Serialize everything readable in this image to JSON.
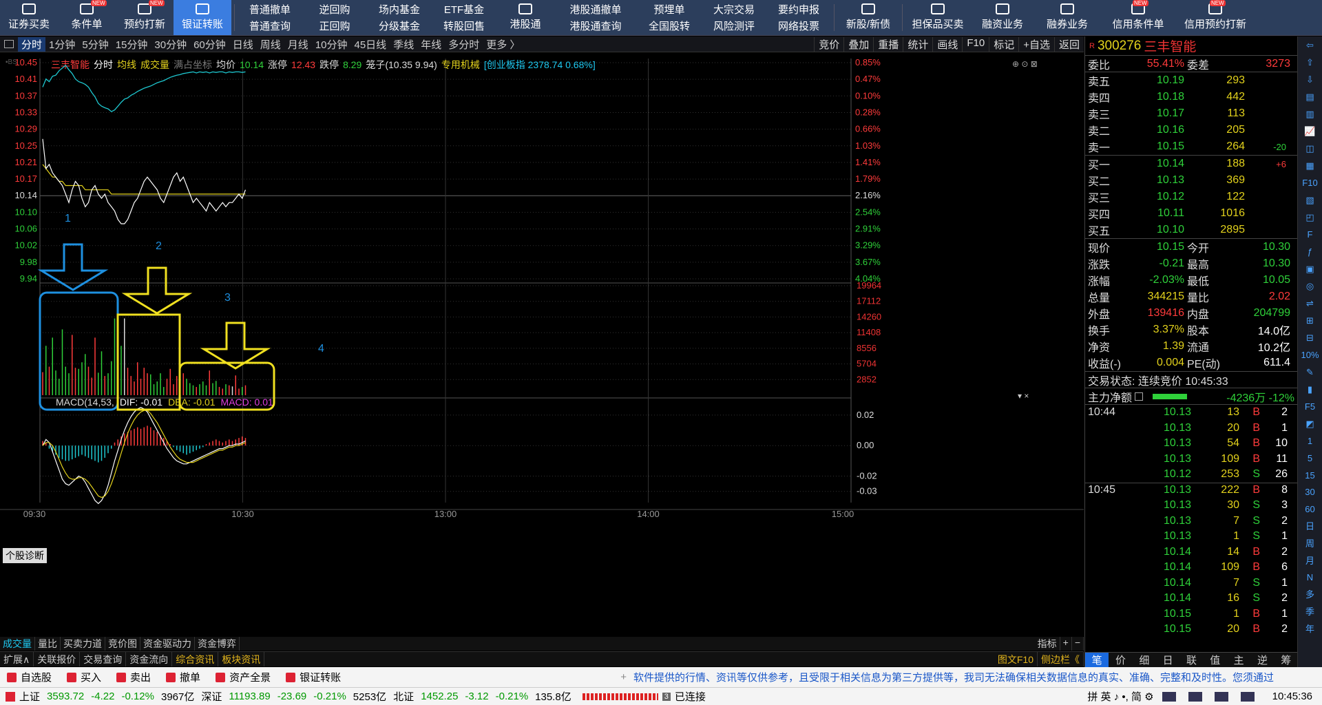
{
  "toolbar": {
    "big": [
      {
        "label": "证券买卖",
        "icon": "chart-up-icon"
      },
      {
        "label": "条件单",
        "icon": "condition-icon",
        "new": true
      },
      {
        "label": "预约打新",
        "icon": "reserve-icon",
        "new": true
      },
      {
        "label": "银证转账",
        "icon": "transfer-icon",
        "active": true
      }
    ],
    "pairs": [
      [
        "普通撤单",
        "普通查询"
      ],
      [
        "逆回购",
        "正回购"
      ],
      [
        "场内基金",
        "分级基金"
      ],
      [
        "ETF基金",
        "转股回售"
      ]
    ],
    "hk": {
      "label": "港股通",
      "icon": "hk-icon"
    },
    "pairs2": [
      [
        "港股通撤单",
        "港股通查询"
      ],
      [
        "预埋单",
        "全国股转"
      ],
      [
        "大宗交易",
        "风险测评"
      ],
      [
        "要约申报",
        "网络投票"
      ]
    ],
    "xin": {
      "label": "新股/新债",
      "icon": "new-stock-icon"
    },
    "big2": [
      {
        "label": "担保品买卖",
        "icon": "shield-icon"
      },
      {
        "label": "融资业务",
        "icon": "coin-icon"
      },
      {
        "label": "融券业务",
        "icon": "coin2-icon"
      },
      {
        "label": "信用条件单",
        "icon": "credit-condition-icon",
        "new": true
      },
      {
        "label": "信用预约打新",
        "icon": "credit-reserve-icon",
        "new": true
      }
    ],
    "new_badge": "NEW"
  },
  "period_bar": {
    "items": [
      "分时",
      "1分钟",
      "5分钟",
      "15分钟",
      "30分钟",
      "60分钟",
      "日线",
      "周线",
      "月线",
      "10分钟",
      "45日线",
      "季线",
      "年线",
      "多分时",
      "更多 〉"
    ],
    "active": "分时",
    "right": [
      "竞价",
      "叠加",
      "重播",
      "统计",
      "画线",
      "F10",
      "标记",
      "+自选",
      "返回"
    ]
  },
  "chart_header": {
    "name": "三丰智能",
    "mode": "分时",
    "avg": "均线",
    "vol": "成交量",
    "full": "满占坐标",
    "avg_price_label": "均价",
    "avg_price": "10.14",
    "limit_up_label": "涨停",
    "limit_up": "12.43",
    "limit_down_label": "跌停",
    "limit_down": "8.29",
    "range": "笼子(10.35 9.94)",
    "industry": "专用机械",
    "index": "[创业板指 2378.74 0.68%]"
  },
  "price_axis": [
    "10.45",
    "10.41",
    "10.37",
    "10.33",
    "10.29",
    "10.25",
    "10.21",
    "10.17",
    "10.14",
    "10.10",
    "10.06",
    "10.02",
    "9.98",
    "9.94"
  ],
  "pct_axis": [
    "0.85%",
    "0.47%",
    "0.10%",
    "0.28%",
    "0.66%",
    "1.03%",
    "1.41%",
    "1.79%",
    "2.16%",
    "2.54%",
    "2.91%",
    "3.29%",
    "3.67%",
    "4.04%"
  ],
  "vol_axis": [
    "19964",
    "17112",
    "14260",
    "11408",
    "8556",
    "5704",
    "2852"
  ],
  "macd_axis": [
    "0.02",
    "0.00",
    "-0.02",
    "-0.03"
  ],
  "time_axis": [
    "09:30",
    "10:30",
    "13:00",
    "14:00",
    "15:00"
  ],
  "macd_label": {
    "name": "MACD(14,53,",
    "dif": "DIF: -0.01",
    "dea": "DEA: -0.01",
    "macd": "MACD: 0.01"
  },
  "annotations": [
    "1",
    "2",
    "3",
    "4"
  ],
  "diag_button": "个股诊断",
  "chart_data": {
    "type": "line",
    "series": [
      {
        "name": "price",
        "values": [
          10.27,
          10.2,
          10.21,
          10.19,
          10.18,
          10.17,
          10.16,
          10.14,
          10.12,
          10.15,
          10.17,
          10.16,
          10.13,
          10.11,
          10.12,
          10.15,
          10.16,
          10.14,
          10.13,
          10.14,
          10.12,
          10.11,
          10.1,
          10.08,
          10.07,
          10.07,
          10.08,
          10.1,
          10.12,
          10.13,
          10.15,
          10.17,
          10.18,
          10.17,
          10.16,
          10.15,
          10.13,
          10.12,
          10.14,
          10.16,
          10.18,
          10.19,
          10.17,
          10.18,
          10.16,
          10.14,
          10.12,
          10.13,
          10.12,
          10.11,
          10.1,
          10.12,
          10.11,
          10.1,
          10.11,
          10.12,
          10.11,
          10.12,
          10.12,
          10.13,
          10.14,
          10.13,
          10.15
        ]
      },
      {
        "name": "avg",
        "values": [
          10.21,
          10.2,
          10.19,
          10.18,
          10.18,
          10.17,
          10.17,
          10.16,
          10.16,
          10.16,
          10.16,
          10.16,
          10.16,
          10.15,
          10.15,
          10.15,
          10.15,
          10.15,
          10.15,
          10.15,
          10.15,
          10.14,
          10.14,
          10.14,
          10.14,
          10.14,
          10.14,
          10.14,
          10.14,
          10.14,
          10.14,
          10.14,
          10.14,
          10.14,
          10.14,
          10.14,
          10.14,
          10.14,
          10.14,
          10.14,
          10.14,
          10.14,
          10.14,
          10.14,
          10.14,
          10.14,
          10.14,
          10.14,
          10.14,
          10.14,
          10.14,
          10.14,
          10.14,
          10.14,
          10.14,
          10.14,
          10.14,
          10.14,
          10.14,
          10.14,
          10.14,
          10.14,
          10.14
        ]
      },
      {
        "name": "index_pct",
        "values": [
          0.4,
          0.55,
          0.5,
          0.6,
          0.62,
          0.7,
          0.75,
          0.8,
          0.72,
          0.65,
          0.55,
          0.5,
          0.48,
          0.45,
          0.4,
          0.3,
          0.22,
          0.1,
          0.05,
          0.02,
          0.0,
          -0.05,
          -0.02,
          0.05,
          0.12,
          0.18,
          0.2,
          0.25,
          0.28,
          0.32,
          0.35,
          0.38,
          0.4,
          0.42,
          0.45,
          0.48,
          0.5,
          0.52,
          0.55,
          0.58,
          0.6,
          0.62,
          0.63,
          0.65,
          0.66,
          0.67,
          0.68,
          0.66,
          0.68,
          0.67,
          0.68,
          0.66,
          0.68,
          0.67,
          0.68,
          0.68,
          0.66,
          0.68,
          0.67,
          0.68,
          0.68,
          0.67,
          0.68
        ]
      },
      {
        "name": "volume",
        "values": [
          4200,
          9000,
          5200,
          10500,
          4500,
          3000,
          12000,
          5200,
          4000,
          11000,
          5000,
          4800,
          6000,
          7500,
          5200,
          3200,
          10500,
          4100,
          8000,
          3500,
          4000,
          6200,
          14000,
          11000,
          9000,
          14000,
          5000,
          3500,
          2500,
          6000,
          3000,
          5000,
          4000,
          3800,
          2000,
          2500,
          4000,
          1500,
          3000,
          4800,
          2000,
          3500,
          2800,
          4000,
          3000,
          2200,
          1800,
          1500,
          2000,
          2500,
          1800,
          4500,
          2200,
          2600,
          1500,
          1200,
          2000,
          1800,
          1600,
          3600,
          1200,
          1500,
          1800
        ]
      },
      {
        "name": "macd_hist",
        "values": [
          0.003,
          0.002,
          -0.002,
          -0.004,
          -0.006,
          -0.008,
          -0.009,
          -0.01,
          -0.01,
          -0.009,
          -0.008,
          -0.007,
          -0.006,
          -0.007,
          -0.008,
          -0.009,
          -0.01,
          -0.011,
          -0.01,
          -0.008,
          -0.005,
          -0.002,
          0.002,
          0.004,
          0.006,
          0.008,
          0.009,
          0.01,
          0.011,
          0.012,
          0.011,
          0.012,
          0.013,
          0.012,
          0.01,
          0.009,
          0.007,
          0.005,
          0.003,
          0.001,
          -0.001,
          -0.003,
          -0.004,
          -0.005,
          -0.006,
          -0.005,
          -0.004,
          -0.003,
          -0.002,
          -0.001,
          0.001,
          0.002,
          0.003,
          0.004,
          0.003,
          0.002,
          0.003,
          0.004,
          0.003,
          0.004,
          0.005,
          0.006,
          0.005
        ]
      },
      {
        "name": "dif",
        "values": [
          0.0,
          0.004,
          0.002,
          -0.004,
          -0.01,
          -0.016,
          -0.022,
          -0.025,
          -0.026,
          -0.024,
          -0.022,
          -0.02,
          -0.021,
          -0.024,
          -0.028,
          -0.032,
          -0.036,
          -0.038,
          -0.036,
          -0.032,
          -0.026,
          -0.018,
          -0.01,
          -0.003,
          0.004,
          0.01,
          0.015,
          0.019,
          0.022,
          0.024,
          0.025,
          0.024,
          0.022,
          0.018,
          0.014,
          0.01,
          0.006,
          0.002,
          -0.002,
          -0.005,
          -0.008,
          -0.01,
          -0.011,
          -0.012,
          -0.012,
          -0.011,
          -0.01,
          -0.009,
          -0.008,
          -0.007,
          -0.006,
          -0.005,
          -0.004,
          -0.003,
          -0.002,
          -0.002,
          -0.001,
          0.0,
          0.0,
          0.001,
          0.001,
          0.002,
          0.003
        ]
      },
      {
        "name": "dea",
        "values": [
          0.0,
          0.002,
          0.002,
          0.0,
          -0.004,
          -0.009,
          -0.014,
          -0.018,
          -0.021,
          -0.022,
          -0.022,
          -0.021,
          -0.021,
          -0.022,
          -0.024,
          -0.027,
          -0.03,
          -0.033,
          -0.034,
          -0.033,
          -0.03,
          -0.025,
          -0.019,
          -0.012,
          -0.005,
          0.002,
          0.008,
          0.013,
          0.017,
          0.02,
          0.022,
          0.023,
          0.023,
          0.021,
          0.018,
          0.015,
          0.011,
          0.007,
          0.003,
          -0.001,
          -0.004,
          -0.007,
          -0.009,
          -0.01,
          -0.011,
          -0.011,
          -0.011,
          -0.01,
          -0.009,
          -0.008,
          -0.007,
          -0.006,
          -0.005,
          -0.004,
          -0.003,
          -0.003,
          -0.002,
          -0.001,
          -0.001,
          0.0,
          0.0,
          0.001,
          0.002
        ]
      }
    ],
    "ylim_price": [
      9.94,
      10.45
    ],
    "ylim_vol": [
      0,
      19964
    ],
    "ylim_macd": [
      -0.036,
      0.024
    ]
  },
  "bottom_tabs": [
    "成交量",
    "量比",
    "买卖力道",
    "竞价图",
    "资金驱动力",
    "资金博弈"
  ],
  "bottom_tabs_right": [
    "指标",
    "+",
    "−"
  ],
  "info_tabs": [
    "扩展∧",
    "关联报价",
    "交易查询",
    "资金流向",
    "综合资讯",
    "板块资讯"
  ],
  "info_tabs_right": [
    "图文F10",
    "侧边栏《"
  ],
  "right_tabs": [
    "笔",
    "价",
    "细",
    "日",
    "联",
    "值",
    "主",
    "逆",
    "筹"
  ],
  "quote": {
    "code": "300276",
    "name": "三丰智能",
    "r_badge": "R",
    "ratio_label": "委比",
    "ratio": "55.41%",
    "diff_label": "委差",
    "diff": "3273",
    "sell": [
      [
        "卖五",
        "10.19",
        "293",
        ""
      ],
      [
        "卖四",
        "10.18",
        "442",
        ""
      ],
      [
        "卖三",
        "10.17",
        "113",
        ""
      ],
      [
        "卖二",
        "10.16",
        "205",
        ""
      ],
      [
        "卖一",
        "10.15",
        "264",
        "-20"
      ]
    ],
    "buy": [
      [
        "买一",
        "10.14",
        "188",
        "+6"
      ],
      [
        "买二",
        "10.13",
        "369",
        ""
      ],
      [
        "买三",
        "10.12",
        "122",
        ""
      ],
      [
        "买四",
        "10.11",
        "1016",
        ""
      ],
      [
        "买五",
        "10.10",
        "2895",
        ""
      ]
    ],
    "stats": [
      [
        "现价",
        "10.15",
        "今开",
        "10.30"
      ],
      [
        "涨跌",
        "-0.21",
        "最高",
        "10.30"
      ],
      [
        "涨幅",
        "-2.03%",
        "最低",
        "10.05"
      ],
      [
        "总量",
        "344215",
        "量比",
        "2.02"
      ],
      [
        "外盘",
        "139416",
        "内盘",
        "204799"
      ],
      [
        "换手",
        "3.37%",
        "股本",
        "14.0亿"
      ],
      [
        "净资",
        "1.39",
        "流通",
        "10.2亿"
      ],
      [
        "收益(-)",
        "0.004",
        "PE(动)",
        "611.4"
      ]
    ],
    "trade_status": "交易状态: 连续竞价 10:45:33",
    "main_flow_label": "主力净额",
    "main_flow": "-4236万 -12%",
    "ticks": [
      {
        "t": "10:44",
        "p": "10.13",
        "v": "13",
        "s": "B",
        "n": "2"
      },
      {
        "t": "",
        "p": "10.13",
        "v": "20",
        "s": "B",
        "n": "1"
      },
      {
        "t": "",
        "p": "10.13",
        "v": "54",
        "s": "B",
        "n": "10"
      },
      {
        "t": "",
        "p": "10.13",
        "v": "109",
        "s": "B",
        "n": "11"
      },
      {
        "t": "",
        "p": "10.12",
        "v": "253",
        "s": "S",
        "n": "26"
      },
      {
        "t": "10:45",
        "p": "10.13",
        "v": "222",
        "s": "B",
        "n": "8"
      },
      {
        "t": "",
        "p": "10.13",
        "v": "30",
        "s": "S",
        "n": "3"
      },
      {
        "t": "",
        "p": "10.13",
        "v": "7",
        "s": "S",
        "n": "2"
      },
      {
        "t": "",
        "p": "10.13",
        "v": "1",
        "s": "S",
        "n": "1"
      },
      {
        "t": "",
        "p": "10.14",
        "v": "14",
        "s": "B",
        "n": "2"
      },
      {
        "t": "",
        "p": "10.14",
        "v": "109",
        "s": "B",
        "n": "6"
      },
      {
        "t": "",
        "p": "10.14",
        "v": "7",
        "s": "S",
        "n": "1"
      },
      {
        "t": "",
        "p": "10.14",
        "v": "16",
        "s": "S",
        "n": "2"
      },
      {
        "t": "",
        "p": "10.15",
        "v": "1",
        "s": "B",
        "n": "1"
      },
      {
        "t": "",
        "p": "10.15",
        "v": "20",
        "s": "B",
        "n": "2"
      }
    ]
  },
  "sidebar": [
    "⇦",
    "⇧",
    "⇩",
    "▤",
    "▥",
    "📈",
    "◫",
    "▦",
    "F10",
    "▧",
    "◰",
    "F",
    "ƒ",
    "▣",
    "◎",
    "⇌",
    "⊞",
    "⊟",
    "10%",
    "✎",
    "▮",
    "F5",
    "◩",
    "1",
    "5",
    "15",
    "30",
    "60",
    "日",
    "周",
    "月",
    "N",
    "多",
    "季",
    "年"
  ],
  "quick_bar": {
    "items": [
      "自选股",
      "买入",
      "卖出",
      "撤单",
      "资产全景",
      "银证转账"
    ],
    "marquee": "软件提供的行情、资讯等仅供参考，且受限于相关信息为第三方提供等，我司无法确保相关数据信息的真实、准确、完整和及时性。您须通过"
  },
  "status": {
    "sh_label": "上证",
    "sh": "3593.72",
    "sh_chg": "-4.22",
    "sh_pct": "-0.12%",
    "sh_amt": "3967亿",
    "sz_label": "深证",
    "sz": "11193.89",
    "sz_chg": "-23.69",
    "sz_pct": "-0.21%",
    "sz_amt": "5253亿",
    "bz_label": "北证",
    "bz": "1452.25",
    "bz_chg": "-3.12",
    "bz_pct": "-0.21%",
    "bz_amt": "135.8亿",
    "conn": "已连接",
    "conn_num": "3",
    "ime": "拼 英 ♪ •, 简 ⚙",
    "time": "10:45:36"
  }
}
